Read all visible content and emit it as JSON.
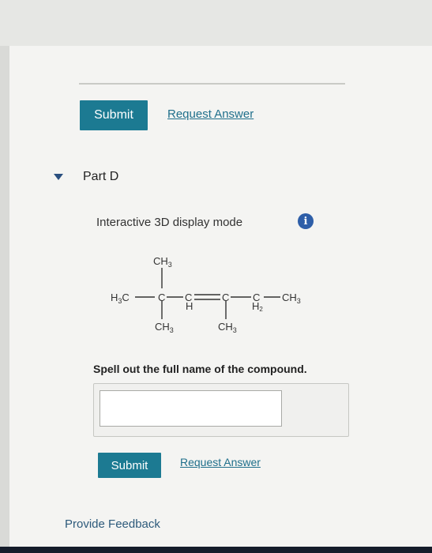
{
  "top_actions": {
    "submit_label": "Submit",
    "request_answer_label": "Request Answer"
  },
  "part": {
    "title": "Part D",
    "display_mode": "Interactive 3D display mode",
    "info_symbol": "i",
    "prompt": "Spell out the full name of the compound.",
    "answer_value": "",
    "submit_label": "Submit",
    "request_answer_label": "Request Answer"
  },
  "molecule": {
    "top_ch3": "CH",
    "top_ch3_sub": "3",
    "left_group": "H",
    "left_group_sub": "3",
    "left_group_tail": "C",
    "c1": "C",
    "c2": "C",
    "c2_h": "H",
    "c3": "C",
    "c4": "C",
    "c4_h2": "H",
    "c4_h2_sub": "2",
    "right_ch3": "CH",
    "right_ch3_sub": "3",
    "bottom_ch3_a": "CH",
    "bottom_ch3_a_sub": "3",
    "bottom_ch3_b": "CH",
    "bottom_ch3_b_sub": "3"
  },
  "footer": {
    "feedback_label": "Provide Feedback"
  },
  "colors": {
    "button": "#1c7a92",
    "link": "#1f6f8b",
    "info": "#2e5ea8"
  }
}
